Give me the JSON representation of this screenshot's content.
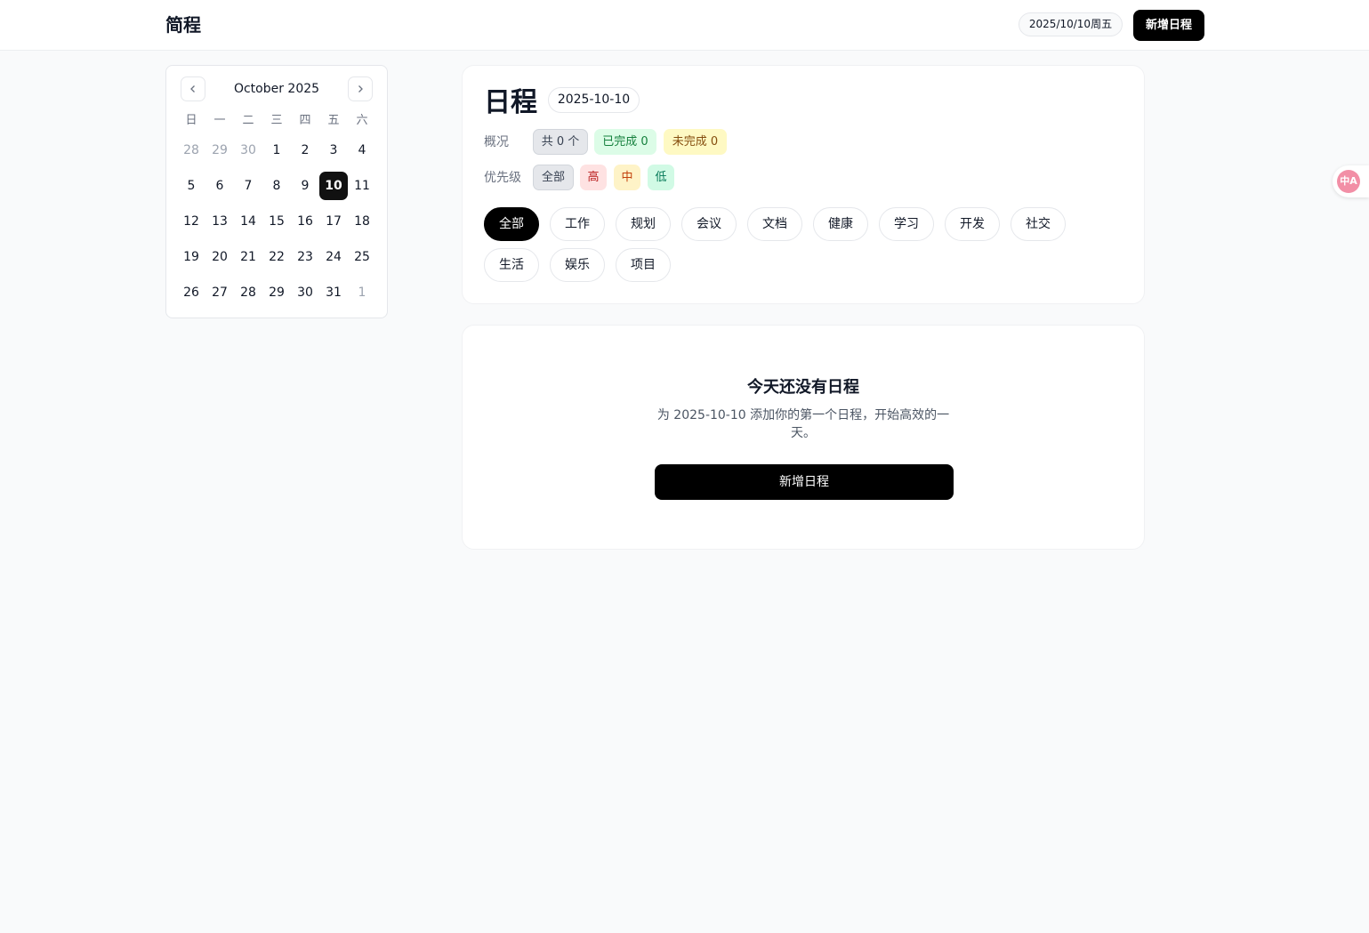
{
  "header": {
    "brand": "简程",
    "date_display": "2025/10/10周五",
    "add_button": "新增日程"
  },
  "calendar": {
    "month_label": "October 2025",
    "weekdays": [
      "日",
      "一",
      "二",
      "三",
      "四",
      "五",
      "六"
    ],
    "weeks": [
      [
        {
          "d": "28",
          "out": true
        },
        {
          "d": "29",
          "out": true
        },
        {
          "d": "30",
          "out": true
        },
        {
          "d": "1"
        },
        {
          "d": "2"
        },
        {
          "d": "3"
        },
        {
          "d": "4"
        }
      ],
      [
        {
          "d": "5"
        },
        {
          "d": "6"
        },
        {
          "d": "7"
        },
        {
          "d": "8"
        },
        {
          "d": "9"
        },
        {
          "d": "10",
          "selected": true
        },
        {
          "d": "11"
        }
      ],
      [
        {
          "d": "12"
        },
        {
          "d": "13"
        },
        {
          "d": "14"
        },
        {
          "d": "15"
        },
        {
          "d": "16"
        },
        {
          "d": "17"
        },
        {
          "d": "18"
        }
      ],
      [
        {
          "d": "19"
        },
        {
          "d": "20"
        },
        {
          "d": "21"
        },
        {
          "d": "22"
        },
        {
          "d": "23"
        },
        {
          "d": "24"
        },
        {
          "d": "25"
        }
      ],
      [
        {
          "d": "26"
        },
        {
          "d": "27"
        },
        {
          "d": "28"
        },
        {
          "d": "29"
        },
        {
          "d": "30"
        },
        {
          "d": "31"
        },
        {
          "d": "1",
          "out": true
        }
      ]
    ]
  },
  "main": {
    "title": "日程",
    "date": "2025-10-10",
    "overview_label": "概况",
    "overview": {
      "total": "共 0 个",
      "done": "已完成 0",
      "todo": "未完成 0"
    },
    "priority_label": "优先级",
    "priority": {
      "all": "全部",
      "high": "高",
      "mid": "中",
      "low": "低"
    },
    "categories": [
      "全部",
      "工作",
      "规划",
      "会议",
      "文档",
      "健康",
      "学习",
      "开发",
      "社交",
      "生活",
      "娱乐",
      "项目"
    ],
    "active_category": "全部"
  },
  "empty": {
    "title": "今天还没有日程",
    "description": "为 2025-10-10 添加你的第一个日程，开始高效的一天。",
    "button": "新增日程"
  },
  "translate_widget": {
    "icon": "translate-icon",
    "glyph": "中A"
  }
}
